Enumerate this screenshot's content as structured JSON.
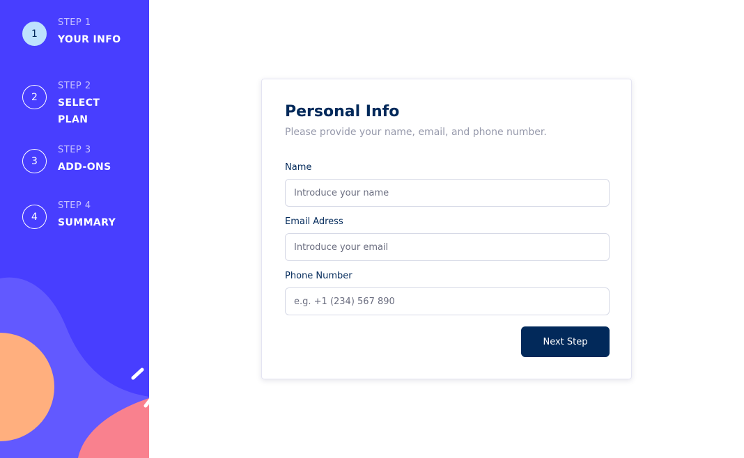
{
  "sidebar": {
    "steps": [
      {
        "number": "1",
        "label": "STEP 1",
        "title": "YOUR INFO",
        "active": true
      },
      {
        "number": "2",
        "label": "STEP 2",
        "title": "SELECT PLAN",
        "active": false
      },
      {
        "number": "3",
        "label": "STEP 3",
        "title": "ADD-ONS",
        "active": false
      },
      {
        "number": "4",
        "label": "STEP 4",
        "title": "SUMMARY",
        "active": false
      }
    ]
  },
  "form": {
    "title": "Personal Info",
    "subtitle": "Please provide your name, email, and phone number.",
    "name": {
      "label": "Name",
      "placeholder": "Introduce your name",
      "value": ""
    },
    "email": {
      "label": "Email Adress",
      "placeholder": "Introduce your email",
      "value": ""
    },
    "phone": {
      "label": "Phone Number",
      "placeholder": "e.g. +1 (234) 567 890",
      "value": ""
    },
    "next_label": "Next Step"
  },
  "colors": {
    "sidebar_bg": "#483eff",
    "active_step": "#bee2fd",
    "primary_text": "#02295a",
    "button_bg": "#02295a",
    "muted_text": "#9699ab",
    "blob_orange": "#ffaf7e",
    "blob_pink": "#f9818e",
    "blob_lavender": "#6259ff"
  }
}
